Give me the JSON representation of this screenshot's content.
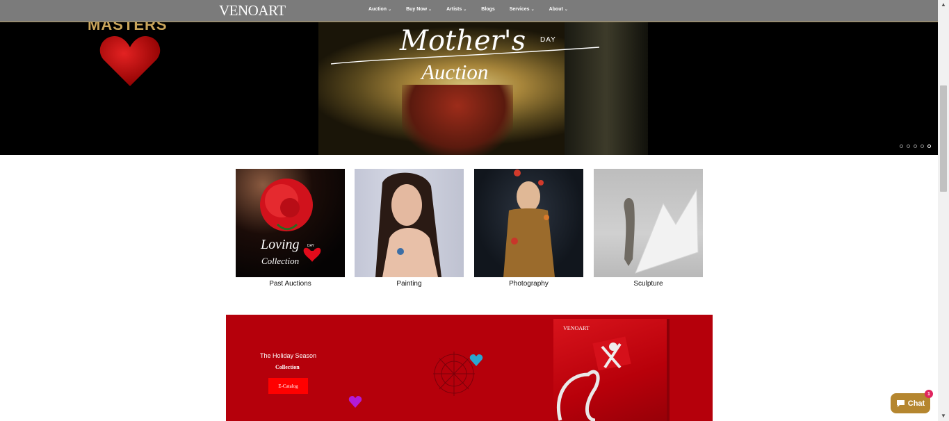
{
  "header": {
    "logo": "VENOART",
    "nav": [
      {
        "label": "Auction",
        "has_dropdown": true
      },
      {
        "label": "Buy Now",
        "has_dropdown": true
      },
      {
        "label": "Artists",
        "has_dropdown": true
      },
      {
        "label": "Blogs",
        "has_dropdown": false
      },
      {
        "label": "Services",
        "has_dropdown": true
      },
      {
        "label": "About",
        "has_dropdown": true
      }
    ]
  },
  "hero": {
    "left_word": "MASTERS",
    "script_title": "Mother's",
    "day": "DAY",
    "title": "Auction",
    "slides": 5,
    "active_slide": 5
  },
  "categories": [
    {
      "label": "Past Auctions",
      "overlay_title": "Loving",
      "overlay_day": "DAY",
      "overlay_sub": "Collection"
    },
    {
      "label": "Painting"
    },
    {
      "label": "Photography"
    },
    {
      "label": "Sculpture"
    }
  ],
  "promo": {
    "heading": "The Holiday Season",
    "subheading": "Collection",
    "button": "E-Catalog",
    "catalog_logo": "VENOART"
  },
  "chat": {
    "label": "Chat",
    "badge": "1"
  },
  "colors": {
    "nav_bg": "#7b7b7b",
    "promo_bg": "#b5000b",
    "promo_button": "#ff0000",
    "chat_bg": "#b5862f"
  }
}
